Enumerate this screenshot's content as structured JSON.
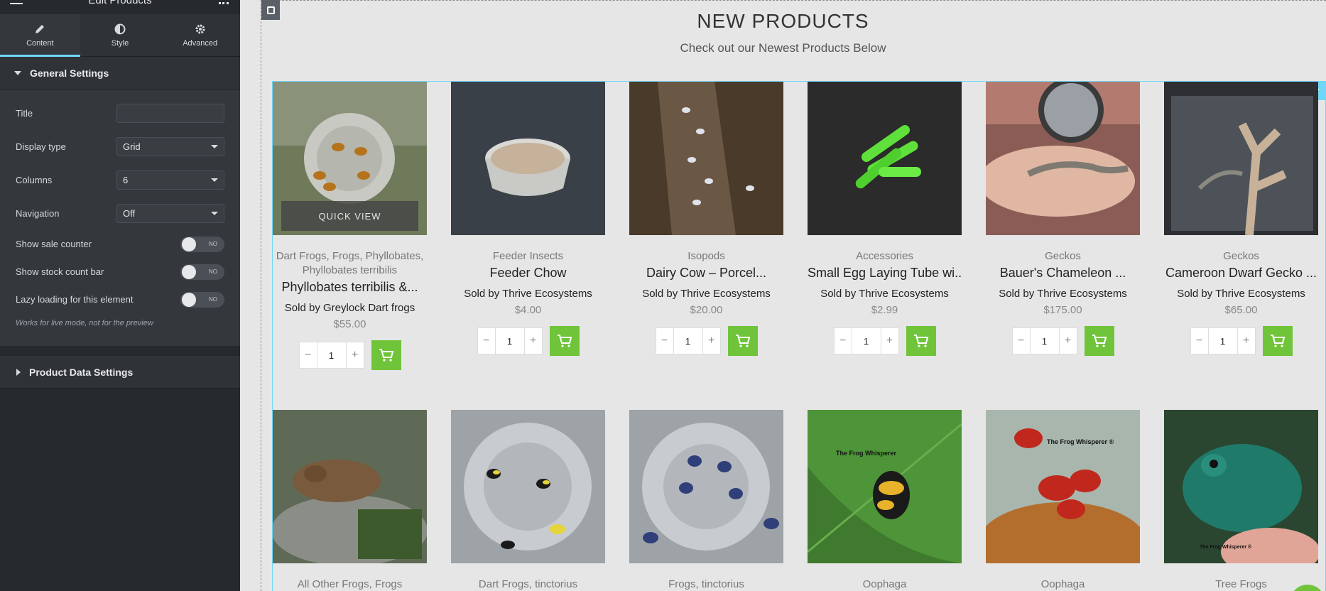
{
  "editor": {
    "title": "Edit Products",
    "tabs": [
      {
        "label": "Content",
        "icon": "pencil-icon"
      },
      {
        "label": "Style",
        "icon": "half-circle-icon"
      },
      {
        "label": "Advanced",
        "icon": "gear-icon"
      }
    ],
    "general_settings": "General Settings",
    "fields": {
      "title_label": "Title",
      "title_value": "",
      "display_type_label": "Display type",
      "display_type_value": "Grid",
      "columns_label": "Columns",
      "columns_value": "6",
      "navigation_label": "Navigation",
      "navigation_value": "Off"
    },
    "toggles": [
      {
        "label": "Show sale counter",
        "state": "NO"
      },
      {
        "label": "Show stock count bar",
        "state": "NO"
      },
      {
        "label": "Lazy loading for this element",
        "state": "NO"
      }
    ],
    "note": "Works for live mode, not for the preview",
    "product_data_settings": "Product Data Settings"
  },
  "preview": {
    "heading": "NEW PRODUCTS",
    "subheading": "Check out our Newest Products Below",
    "quick_view": "QUICK VIEW",
    "products_row1": [
      {
        "category": "Dart Frogs, Frogs, Phyllobates, Phyllobates terribilis",
        "name": "Phyllobates terribilis &...",
        "seller": "Sold by Greylock Dart frogs",
        "price": "$55.00",
        "qty": "1"
      },
      {
        "category": "Feeder Insects",
        "name": "Feeder Chow",
        "seller": "Sold by Thrive Ecosystems",
        "price": "$4.00",
        "qty": "1"
      },
      {
        "category": "Isopods",
        "name": "Dairy Cow – Porcel...",
        "seller": "Sold by Thrive Ecosystems",
        "price": "$20.00",
        "qty": "1"
      },
      {
        "category": "Accessories",
        "name": "Small Egg Laying Tube wi...",
        "seller": "Sold by Thrive Ecosystems",
        "price": "$2.99",
        "qty": "1"
      },
      {
        "category": "Geckos",
        "name": "Bauer's Chameleon ...",
        "seller": "Sold by Thrive Ecosystems",
        "price": "$175.00",
        "qty": "1"
      },
      {
        "category": "Geckos",
        "name": "Cameroon Dwarf Gecko ...",
        "seller": "Sold by Thrive Ecosystems",
        "price": "$65.00",
        "qty": "1"
      }
    ],
    "products_row2": [
      {
        "category": "All Other Frogs, Frogs"
      },
      {
        "category": "Dart Frogs, tinctorius"
      },
      {
        "category": "Frogs, tinctorius"
      },
      {
        "category": "Oophaga",
        "watermark": "The Frog Whisperer"
      },
      {
        "category": "Oophaga",
        "watermark": "The Frog Whisperer ®"
      },
      {
        "category": "Tree Frogs",
        "watermark": "The Frog Whisperer ®"
      }
    ]
  },
  "colors": {
    "accent": "#71d7f7",
    "cart_green": "#6fc43a",
    "sidebar_bg": "#26292d"
  }
}
